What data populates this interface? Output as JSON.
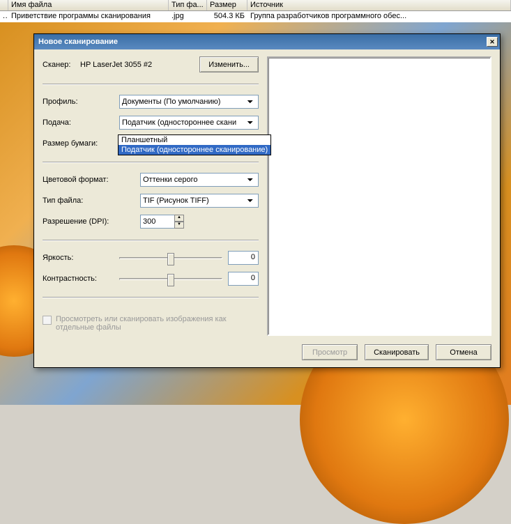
{
  "columns": {
    "filename": "Имя файла",
    "filetype": "Тип фа...",
    "size": "Размер",
    "source": "Источник"
  },
  "file": {
    "prefix": "...",
    "name": "Приветствие программы сканирования",
    "ext": ".jpg",
    "size": "504.3 КБ",
    "source": "Группа разработчиков программного обес..."
  },
  "dialog": {
    "title": "Новое сканирование",
    "scanner_label": "Сканер:",
    "scanner_name": "HP LaserJet 3055 #2",
    "change_btn": "Изменить...",
    "profile_label": "Профиль:",
    "profile_value": "Документы (По умолчанию)",
    "feed_label": "Подача:",
    "feed_value": "Податчик (одностороннее скани",
    "feed_options": [
      "Планшетный",
      "Податчик (одностороннее сканирование)"
    ],
    "paper_label": "Размер бумаги:",
    "color_label": "Цветовой формат:",
    "color_value": "Оттенки серого",
    "filetype_label": "Тип файла:",
    "filetype_value": "TIF (Рисунок TIFF)",
    "dpi_label": "Разрешение (DPI):",
    "dpi_value": "300",
    "brightness_label": "Яркость:",
    "brightness_value": "0",
    "contrast_label": "Контрастность:",
    "contrast_value": "0",
    "preview_checkbox": "Просмотреть или сканировать изображения как отдельные файлы",
    "btn_preview": "Просмотр",
    "btn_scan": "Сканировать",
    "btn_cancel": "Отмена"
  }
}
